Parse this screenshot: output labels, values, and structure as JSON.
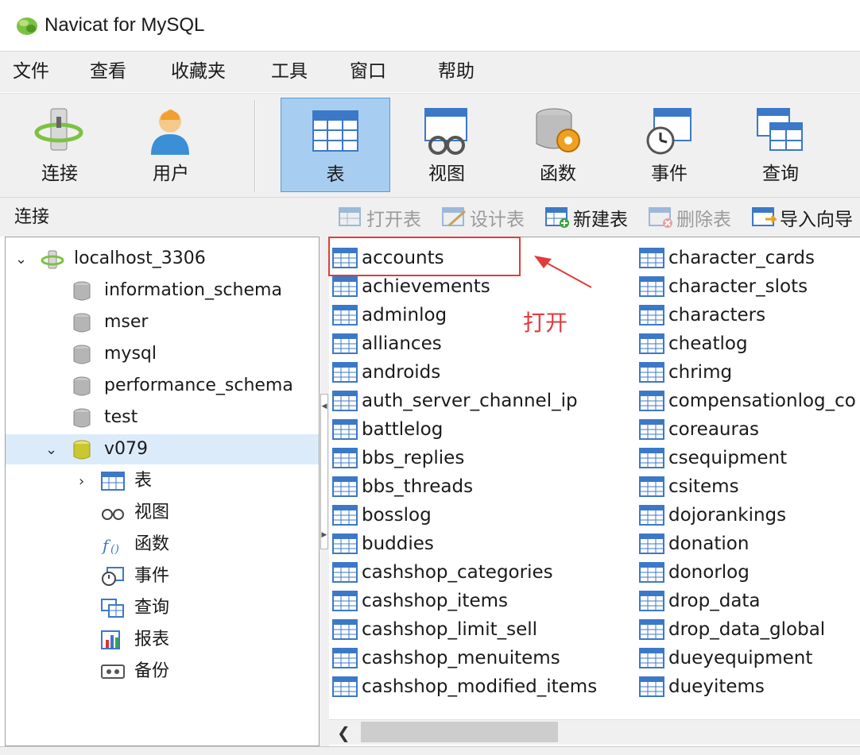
{
  "window": {
    "title": "Navicat for MySQL"
  },
  "menu": [
    "文件",
    "查看",
    "收藏夹",
    "工具",
    "窗口",
    "帮助"
  ],
  "toolbar": {
    "connect": "连接",
    "user": "用户",
    "table": "表",
    "view": "视图",
    "function": "函数",
    "event": "事件",
    "query": "查询"
  },
  "subbar": {
    "title": "连接",
    "open_table": "打开表",
    "design_table": "设计表",
    "new_table": "新建表",
    "delete_table": "删除表",
    "import_wizard": "导入向导"
  },
  "tree": {
    "connection": "localhost_3306",
    "databases": [
      "information_schema",
      "mser",
      "mysql",
      "performance_schema",
      "test"
    ],
    "selected_db": "v079",
    "children": [
      "表",
      "视图",
      "函数",
      "事件",
      "查询",
      "报表",
      "备份"
    ]
  },
  "tables_col1": [
    "accounts",
    "achievements",
    "adminlog",
    "alliances",
    "androids",
    "auth_server_channel_ip",
    "battlelog",
    "bbs_replies",
    "bbs_threads",
    "bosslog",
    "buddies",
    "cashshop_categories",
    "cashshop_items",
    "cashshop_limit_sell",
    "cashshop_menuitems",
    "cashshop_modified_items"
  ],
  "tables_col2": [
    "character_cards",
    "character_slots",
    "characters",
    "cheatlog",
    "chrimg",
    "compensationlog_co",
    "coreauras",
    "csequipment",
    "csitems",
    "dojorankings",
    "donation",
    "donorlog",
    "drop_data",
    "drop_data_global",
    "dueyequipment",
    "dueyitems"
  ],
  "annotation": {
    "text": "打开"
  }
}
